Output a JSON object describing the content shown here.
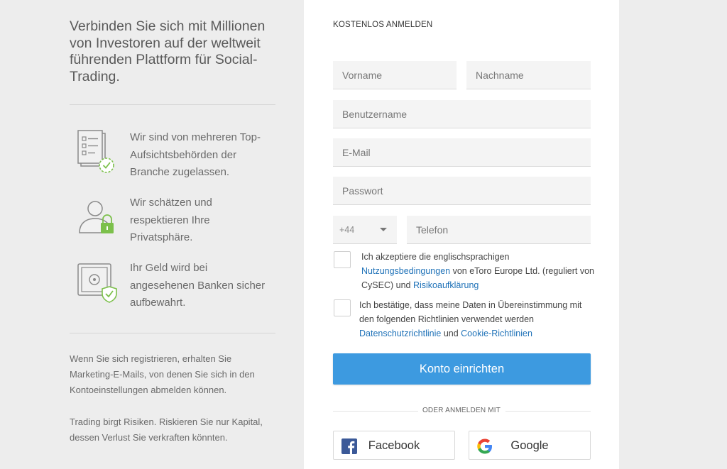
{
  "left": {
    "headline": "Verbinden Sie sich mit Millionen von Investoren auf der weltweit führenden Plattform für Social-Trading.",
    "features": [
      {
        "icon": "checklist-icon",
        "text": "Wir sind von mehreren Top-Aufsichtsbehörden der Branche zugelassen."
      },
      {
        "icon": "user-lock-icon",
        "text": "Wir schätzen und respektieren Ihre Privatsphäre."
      },
      {
        "icon": "safe-shield-icon",
        "text": "Ihr Geld wird bei angesehenen Banken sicher aufbewahrt."
      }
    ],
    "note_marketing": "Wenn Sie sich registrieren, erhalten Sie Marketing-E-Mails, von denen Sie sich in den Kontoeinstellungen abmelden können.",
    "note_risk": "Trading birgt Risiken. Riskieren Sie nur Kapital, dessen Verlust Sie verkraften könnten."
  },
  "form": {
    "title": "KOSTENLOS ANMELDEN",
    "first_name_placeholder": "Vorname",
    "last_name_placeholder": "Nachname",
    "username_placeholder": "Benutzername",
    "email_placeholder": "E-Mail",
    "password_placeholder": "Passwort",
    "country_code": "+44",
    "phone_placeholder": "Telefon",
    "terms": {
      "part1": "Ich akzeptiere die englischsprachigen ",
      "link1": "Nutzungsbedingungen",
      "part2": " von eToro Europe Ltd. (reguliert von CySEC) und ",
      "link2": "Risikoaufklärung"
    },
    "privacy": {
      "part1": "Ich bestätige, dass meine Daten in Übereinstimmung mit den folgenden Richtlinien verwendet werden ",
      "link1": "Datenschutzrichtlinie",
      "part2": " und ",
      "link2": "Cookie-Richtlinien"
    },
    "submit_label": "Konto einrichten",
    "or_label": "ODER ANMELDEN MIT",
    "facebook_label": "Facebook",
    "google_label": "Google"
  },
  "colors": {
    "accent": "#3d9ae0",
    "link": "#1f72b8",
    "icon_green": "#7cc04b",
    "facebook": "#3b5998"
  }
}
